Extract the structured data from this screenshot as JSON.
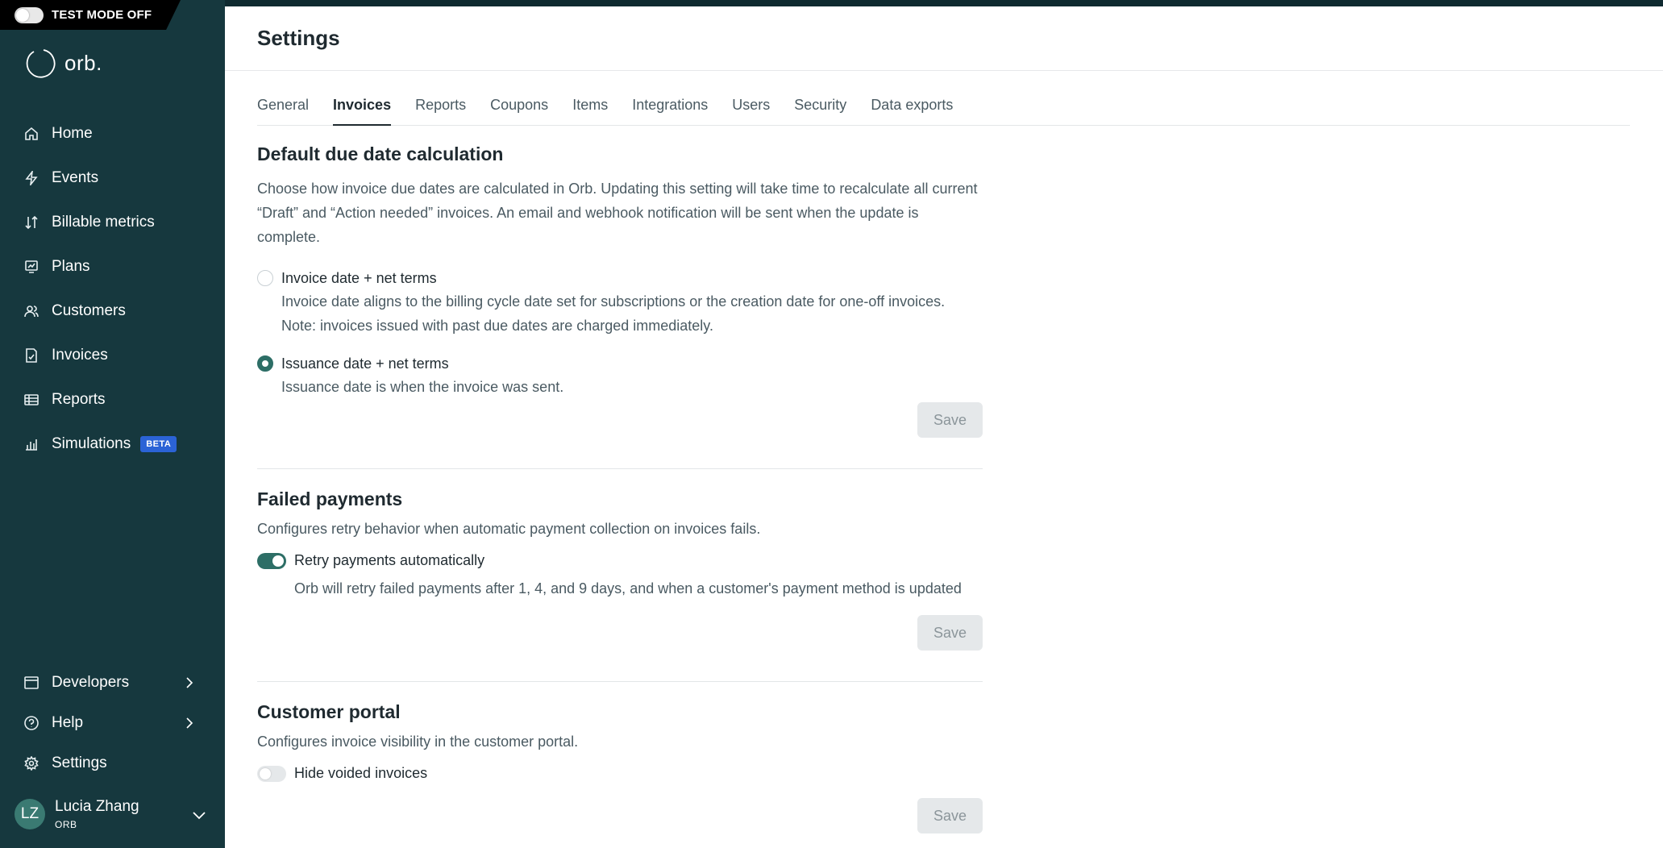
{
  "test_mode": {
    "label": "TEST MODE OFF"
  },
  "brand": {
    "name": "orb."
  },
  "sidebar": {
    "items": [
      {
        "label": "Home",
        "icon": "home-icon"
      },
      {
        "label": "Events",
        "icon": "lightning-icon"
      },
      {
        "label": "Billable metrics",
        "icon": "metrics-icon"
      },
      {
        "label": "Plans",
        "icon": "plans-icon"
      },
      {
        "label": "Customers",
        "icon": "customers-icon"
      },
      {
        "label": "Invoices",
        "icon": "invoice-icon"
      },
      {
        "label": "Reports",
        "icon": "reports-icon"
      },
      {
        "label": "Simulations",
        "icon": "simulations-icon",
        "badge": "BETA"
      }
    ],
    "bottom_items": [
      {
        "label": "Developers",
        "icon": "developers-icon"
      },
      {
        "label": "Help",
        "icon": "help-icon"
      },
      {
        "label": "Settings",
        "icon": "gear-icon"
      }
    ]
  },
  "user": {
    "initials": "LZ",
    "name": "Lucia Zhang",
    "org": "ORB"
  },
  "header": {
    "title": "Settings"
  },
  "tabs": [
    {
      "label": "General"
    },
    {
      "label": "Invoices",
      "active": true
    },
    {
      "label": "Reports"
    },
    {
      "label": "Coupons"
    },
    {
      "label": "Items"
    },
    {
      "label": "Integrations"
    },
    {
      "label": "Users"
    },
    {
      "label": "Security"
    },
    {
      "label": "Data exports"
    }
  ],
  "due_date": {
    "title": "Default due date calculation",
    "description": "Choose how invoice due dates are calculated in Orb. Updating this setting will take time to recalculate all current “Draft” and “Action needed” invoices. An email and webhook notification will be sent when the update is complete.",
    "options": [
      {
        "label": "Invoice date + net terms",
        "description": "Invoice date aligns to the billing cycle date set for subscriptions or the creation date for one-off invoices. Note: invoices issued with past due dates are charged immediately.",
        "selected": false
      },
      {
        "label": "Issuance date + net terms",
        "description": "Issuance date is when the invoice was sent.",
        "selected": true
      }
    ],
    "save_label": "Save"
  },
  "failed_payments": {
    "title": "Failed payments",
    "description": "Configures retry behavior when automatic payment collection on invoices fails.",
    "toggle_label": "Retry payments automatically",
    "toggle_on": true,
    "toggle_description": "Orb will retry failed payments after 1, 4, and 9 days, and when a customer's payment method is updated",
    "save_label": "Save"
  },
  "customer_portal": {
    "title": "Customer portal",
    "description": "Configures invoice visibility in the customer portal.",
    "toggle_label": "Hide voided invoices",
    "toggle_on": false,
    "save_label": "Save"
  },
  "colors": {
    "sidebar": "#16383e",
    "accent": "#2d6e66",
    "beta": "#2b63d6"
  }
}
